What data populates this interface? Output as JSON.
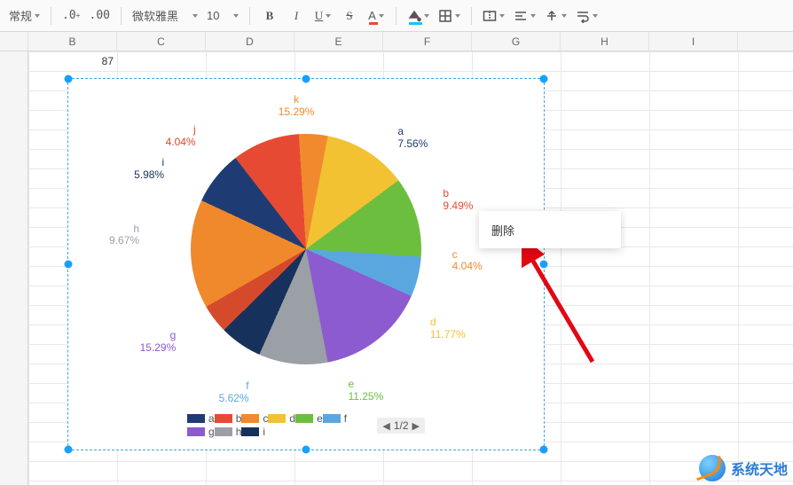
{
  "toolbar": {
    "number_format": "常规",
    "font_name": "微软雅黑",
    "font_size": "10"
  },
  "columns": [
    "B",
    "C",
    "D",
    "E",
    "F",
    "G",
    "H",
    "I"
  ],
  "cell_b1": "87",
  "context_menu": {
    "delete": "删除"
  },
  "legend_pager": "1/2",
  "brand_text": "系统天地",
  "watermark": "",
  "chart_data": {
    "type": "pie",
    "title": "",
    "series": [
      {
        "name": "a",
        "value": 7.56,
        "label": "7.56%",
        "color": "#1f3b73"
      },
      {
        "name": "b",
        "value": 9.49,
        "label": "9.49%",
        "color": "#e74a33"
      },
      {
        "name": "c",
        "value": 4.04,
        "label": "4.04%",
        "color": "#f08a2c"
      },
      {
        "name": "d",
        "value": 11.77,
        "label": "11.77%",
        "color": "#f2c233"
      },
      {
        "name": "e",
        "value": 11.25,
        "label": "11.25%",
        "color": "#6cbf3e"
      },
      {
        "name": "f",
        "value": 5.62,
        "label": "5.62%",
        "color": "#5aa7e0"
      },
      {
        "name": "g",
        "value": 15.29,
        "label": "15.29%",
        "color": "#8c5bcf"
      },
      {
        "name": "h",
        "value": 9.67,
        "label": "9.67%",
        "color": "#9aa0a6"
      },
      {
        "name": "i",
        "value": 5.98,
        "label": "5.98%",
        "color": "#16325c"
      },
      {
        "name": "j",
        "value": 4.04,
        "label": "4.04%",
        "color": "#d64a2c"
      },
      {
        "name": "k",
        "value": 15.29,
        "label": "15.29%",
        "color": "#f0892c"
      }
    ],
    "legend_visible": [
      "a",
      "b",
      "c",
      "d",
      "e",
      "f",
      "g",
      "h",
      "i"
    ]
  }
}
